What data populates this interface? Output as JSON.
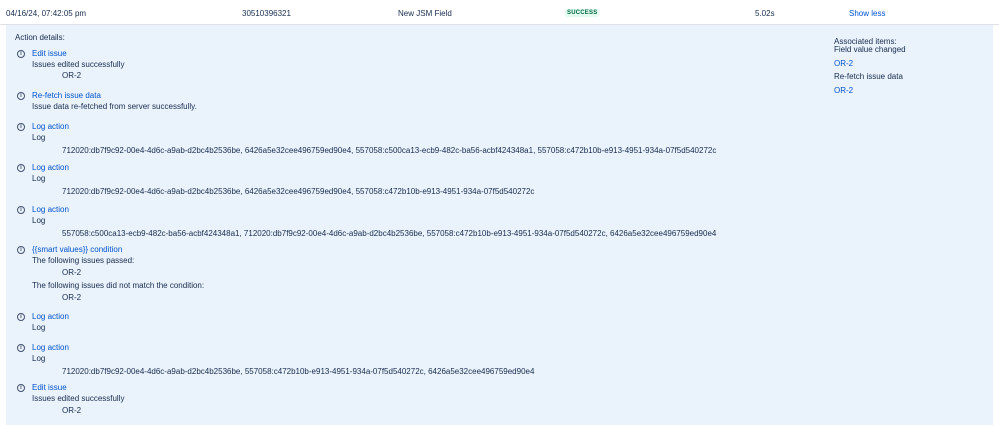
{
  "row": {
    "date": "04/16/24, 07:42:05 pm",
    "id": "30510396321",
    "name": "New JSM Field",
    "status": "SUCCESS",
    "status_color": "#006644",
    "duration": "5.02s",
    "toggle_label": "Show less"
  },
  "details": {
    "title": "Action details:",
    "entries": [
      {
        "icon": "info-icon",
        "title": "Edit issue",
        "lines": [
          "Issues edited successfully",
          "OR-2"
        ]
      },
      {
        "icon": "info-icon",
        "title": "Re-fetch issue data",
        "lines": [
          "Issue data re-fetched from server successfully."
        ]
      },
      {
        "icon": "info-icon",
        "title": "Log action",
        "lines": [
          "Log",
          "712020:db7f9c92-00e4-4d6c-a9ab-d2bc4b2536be, 6426a5e32cee496759ed90e4, 557058:c500ca13-ecb9-482c-ba56-acbf424348a1, 557058:c472b10b-e913-4951-934a-07f5d540272c"
        ]
      },
      {
        "icon": "info-icon",
        "title": "Log action",
        "lines": [
          "Log",
          "712020:db7f9c92-00e4-4d6c-a9ab-d2bc4b2536be, 6426a5e32cee496759ed90e4, 557058:c472b10b-e913-4951-934a-07f5d540272c"
        ]
      },
      {
        "icon": "info-icon",
        "title": "Log action",
        "lines": [
          "Log",
          "557058:c500ca13-ecb9-482c-ba56-acbf424348a1, 712020:db7f9c92-00e4-4d6c-a9ab-d2bc4b2536be, 557058:c472b10b-e913-4951-934a-07f5d540272c, 6426a5e32cee496759ed90e4"
        ]
      },
      {
        "icon": "info-icon",
        "title": "{{smart values}} condition",
        "lines": [
          "The following issues passed:",
          "OR-2",
          "The following issues did not match the condition:",
          "OR-2"
        ]
      },
      {
        "icon": "info-icon",
        "title": "Log action",
        "lines": [
          "Log"
        ]
      },
      {
        "icon": "info-icon",
        "title": "Log action",
        "lines": [
          "Log",
          "712020:db7f9c92-00e4-4d6c-a9ab-d2bc4b2536be, 557058:c472b10b-e913-4951-934a-07f5d540272c, 6426a5e32cee496759ed90e4"
        ]
      },
      {
        "icon": "info-icon",
        "title": "Edit issue",
        "lines": [
          "Issues edited successfully",
          "OR-2"
        ]
      }
    ]
  },
  "associated": {
    "title": "Associated items:",
    "subtitle": "Field value changed",
    "link1": "OR-2",
    "label2": "Re-fetch issue data",
    "link2": "OR-2"
  }
}
